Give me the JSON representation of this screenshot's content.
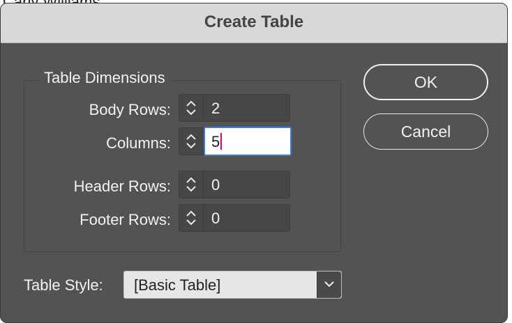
{
  "background": {
    "partial_text": "Carly Williams"
  },
  "dialog": {
    "title": "Create Table",
    "dimensions": {
      "group_title": "Table Dimensions",
      "body_rows": {
        "label": "Body Rows:",
        "value": "2"
      },
      "columns": {
        "label": "Columns:",
        "value": "5"
      },
      "header_rows": {
        "label": "Header Rows:",
        "value": "0"
      },
      "footer_rows": {
        "label": "Footer Rows:",
        "value": "0"
      }
    },
    "table_style": {
      "label": "Table Style:",
      "selected": "[Basic Table]"
    },
    "buttons": {
      "ok": "OK",
      "cancel": "Cancel"
    }
  },
  "colors": {
    "dialog_bg": "#535353",
    "titlebar_bg": "#d8d8d8",
    "focus_ring": "#3f7fd6",
    "text_caret": "#e0006a"
  },
  "icons": {
    "spinner": "up-down-chevron-icon",
    "dropdown": "chevron-down-icon"
  }
}
